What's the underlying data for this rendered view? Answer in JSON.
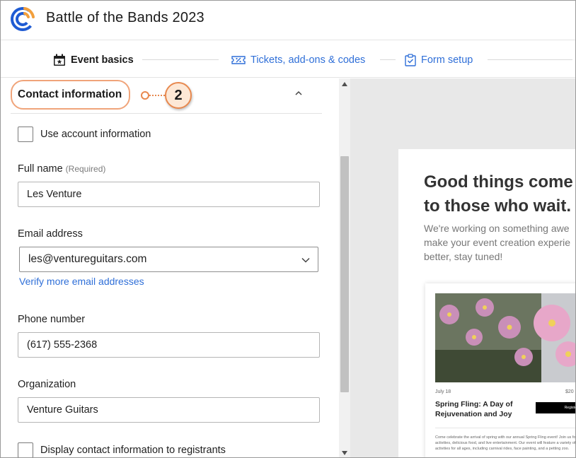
{
  "header": {
    "title": "Battle of the Bands 2023",
    "logo_icon": "constant-contact-logo-icon"
  },
  "steps": [
    {
      "label": "Event basics",
      "icon": "calendar-star-icon",
      "active": true
    },
    {
      "label": "Tickets, add-ons & codes",
      "icon": "ticket-percent-icon",
      "active": false
    },
    {
      "label": "Form setup",
      "icon": "clipboard-check-icon",
      "active": false
    }
  ],
  "section": {
    "title": "Contact information",
    "callout_number": "2"
  },
  "form": {
    "use_account_label": "Use account information",
    "full_name_label": "Full name",
    "full_name_required": "(Required)",
    "full_name_value": "Les Venture",
    "email_label": "Email address",
    "email_value": "les@ventureguitars.com",
    "verify_link": "Verify more email addresses",
    "phone_label": "Phone number",
    "phone_value": "(617) 555-2368",
    "org_label": "Organization",
    "org_value": "Venture Guitars",
    "display_contact_label": "Display contact information to registrants"
  },
  "preview": {
    "heading": "Good things come\nto those who wait.",
    "subtext": "We're working on something awe\nmake your event creation experie\nbetter, stay tuned!",
    "card_date": "July 18",
    "card_price": "$20",
    "card_title": "Spring Fling: A Day of Rejuvenation and Joy",
    "card_button": "Register",
    "card_body": "Come celebrate the arrival of spring with our annual Spring Fling event! Join us for a day of fun activities, delicious food, and live entertainment. Our event will feature a variety of games and activities for all ages, including carnival rides, face painting, and a petting zoo."
  },
  "colors": {
    "accent_blue": "#2f6fd8",
    "logo_orange": "#f29f3c",
    "callout_orange": "#e8894f",
    "callout_fill": "#fde8d6"
  }
}
